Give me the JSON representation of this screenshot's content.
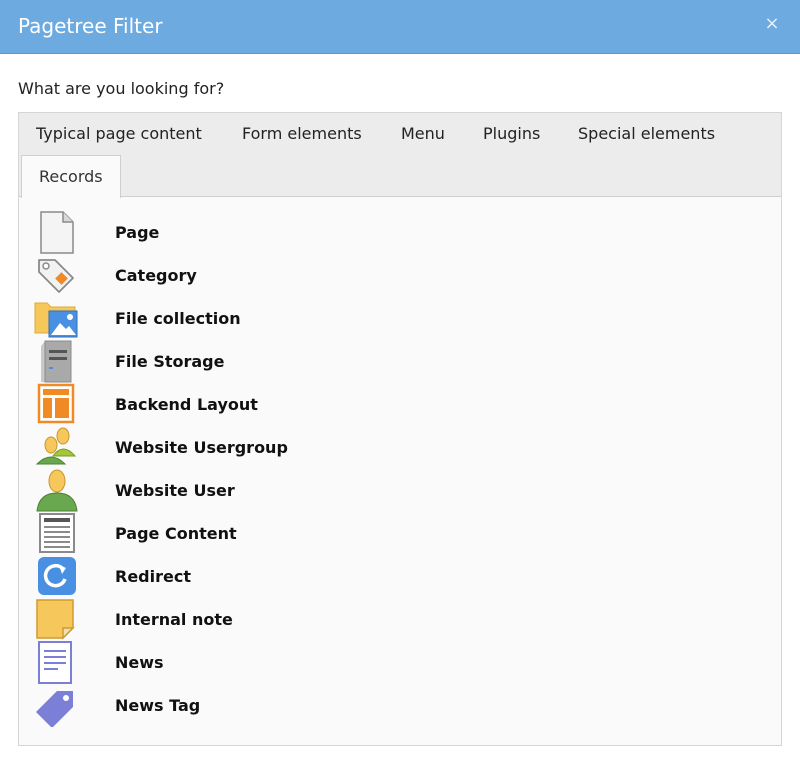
{
  "dialog": {
    "title": "Pagetree Filter",
    "close_glyph": "×"
  },
  "question": "What are you looking for?",
  "tabs": [
    {
      "label": "Typical page content",
      "active": false
    },
    {
      "label": "Form elements",
      "active": false
    },
    {
      "label": "Menu",
      "active": false
    },
    {
      "label": "Plugins",
      "active": false
    },
    {
      "label": "Special elements",
      "active": false
    },
    {
      "label": "Records",
      "active": true
    }
  ],
  "records": [
    {
      "label": "Page",
      "icon": "page-icon"
    },
    {
      "label": "Category",
      "icon": "category-tag-icon"
    },
    {
      "label": "File collection",
      "icon": "file-collection-icon"
    },
    {
      "label": "File Storage",
      "icon": "file-storage-icon"
    },
    {
      "label": "Backend Layout",
      "icon": "backend-layout-icon"
    },
    {
      "label": "Website Usergroup",
      "icon": "usergroup-icon"
    },
    {
      "label": "Website User",
      "icon": "user-icon"
    },
    {
      "label": "Page Content",
      "icon": "page-content-icon"
    },
    {
      "label": "Redirect",
      "icon": "redirect-icon"
    },
    {
      "label": "Internal note",
      "icon": "note-icon"
    },
    {
      "label": "News",
      "icon": "news-icon"
    },
    {
      "label": "News Tag",
      "icon": "news-tag-icon"
    }
  ],
  "colors": {
    "header": "#6daae0",
    "orange": "#f08a24",
    "blue": "#4a90e2",
    "news_purple": "#7b7fd6",
    "user_green": "#6aa84f",
    "note_yellow": "#f6c75a"
  }
}
